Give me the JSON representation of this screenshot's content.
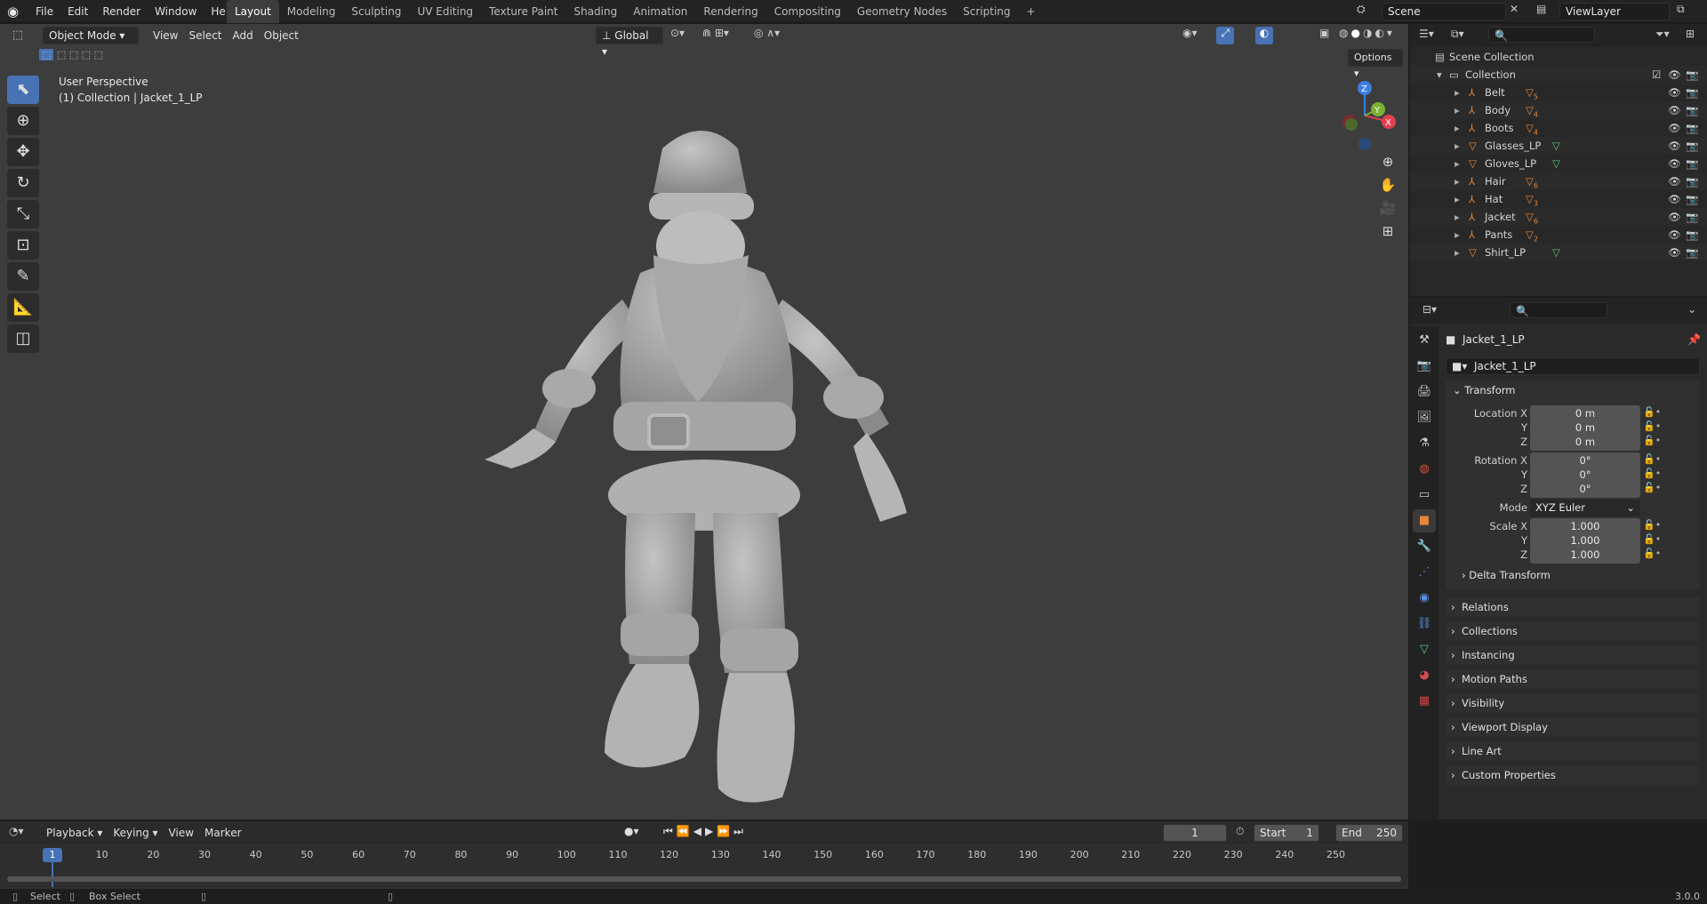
{
  "menu": [
    "File",
    "Edit",
    "Render",
    "Window",
    "Help"
  ],
  "workspaces": [
    "Layout",
    "Modeling",
    "Sculpting",
    "UV Editing",
    "Texture Paint",
    "Shading",
    "Animation",
    "Rendering",
    "Compositing",
    "Geometry Nodes",
    "Scripting"
  ],
  "scene": {
    "name": "Scene",
    "view_layer": "ViewLayer"
  },
  "viewport": {
    "mode": "Object Mode",
    "menus": [
      "View",
      "Select",
      "Add",
      "Object"
    ],
    "orientation": "Global",
    "options_label": "Options",
    "info_line1": "User Perspective",
    "info_line2": "(1) Collection | Jacket_1_LP",
    "gizmo": {
      "x": "X",
      "y": "Y",
      "z": "Z"
    }
  },
  "outliner": {
    "root": "Scene Collection",
    "collection": "Collection",
    "items": [
      {
        "name": "Belt",
        "badge": "5"
      },
      {
        "name": "Body",
        "badge": "4"
      },
      {
        "name": "Boots",
        "badge": "4"
      },
      {
        "name": "Glasses_LP",
        "badge": ""
      },
      {
        "name": "Gloves_LP",
        "badge": ""
      },
      {
        "name": "Hair",
        "badge": "6"
      },
      {
        "name": "Hat",
        "badge": "3"
      },
      {
        "name": "Jacket",
        "badge": "6"
      },
      {
        "name": "Pants",
        "badge": "2"
      },
      {
        "name": "Shirt_LP",
        "badge": ""
      }
    ]
  },
  "properties": {
    "object_name": "Jacket_1_LP",
    "object_field": "Jacket_1_LP",
    "transform_label": "Transform",
    "location": {
      "label": "Location X",
      "x": "0 m",
      "y": "0 m",
      "z": "0 m"
    },
    "rotation": {
      "label": "Rotation X",
      "x": "0°",
      "y": "0°",
      "z": "0°"
    },
    "mode": {
      "label": "Mode",
      "value": "XYZ Euler"
    },
    "scale": {
      "label": "Scale X",
      "x": "1.000",
      "y": "1.000",
      "z": "1.000"
    },
    "axis_y": "Y",
    "axis_z": "Z",
    "delta": "Delta Transform",
    "panels": [
      "Relations",
      "Collections",
      "Instancing",
      "Motion Paths",
      "Visibility",
      "Viewport Display",
      "Line Art",
      "Custom Properties"
    ]
  },
  "timeline": {
    "menus": [
      "Playback",
      "Keying",
      "View",
      "Marker"
    ],
    "current_frame": "1",
    "start_label": "Start",
    "start": "1",
    "end_label": "End",
    "end": "250",
    "ticks": [
      "10",
      "20",
      "30",
      "40",
      "50",
      "60",
      "70",
      "80",
      "90",
      "100",
      "110",
      "120",
      "130",
      "140",
      "150",
      "160",
      "170",
      "180",
      "190",
      "200",
      "210",
      "220",
      "230",
      "240",
      "250"
    ],
    "playhead": "1"
  },
  "status": {
    "select": "Select",
    "box_select": "Box Select",
    "version": "3.0.0"
  },
  "colors": {
    "accent": "#4772b3",
    "orange": "#e8873a",
    "viewport_bg": "#3d3d3d"
  }
}
